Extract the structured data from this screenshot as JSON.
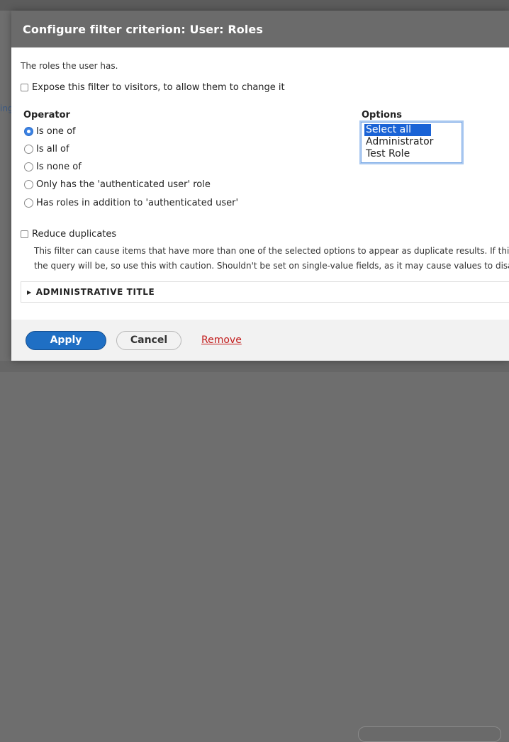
{
  "dialog": {
    "title": "Configure filter criterion: User: Roles",
    "description": "The roles the user has.",
    "expose_label": "Expose this filter to visitors, to allow them to change it",
    "operator": {
      "title": "Operator",
      "options": [
        {
          "label": "Is one of",
          "checked": true
        },
        {
          "label": "Is all of",
          "checked": false
        },
        {
          "label": "Is none of",
          "checked": false
        },
        {
          "label": "Only has the 'authenticated user' role",
          "checked": false
        },
        {
          "label": "Has roles in addition to 'authenticated user'",
          "checked": false
        }
      ]
    },
    "options": {
      "title": "Options",
      "items": [
        "Select all",
        "Administrator",
        "Test Role"
      ],
      "selected": "Select all"
    },
    "reduce_duplicates": {
      "label": "Reduce duplicates",
      "help_line1": "This filter can cause items that have more than one of the selected options to appear as duplicate results. If this",
      "help_line2": "the query will be, so use this with caution. Shouldn't be set on single-value fields, as it may cause values to disa"
    },
    "admin_title_label": "ADMINISTRATIVE TITLE",
    "buttons": {
      "apply": "Apply",
      "cancel": "Cancel",
      "remove": "Remove"
    }
  },
  "background": {
    "link_fragment": "ing"
  }
}
